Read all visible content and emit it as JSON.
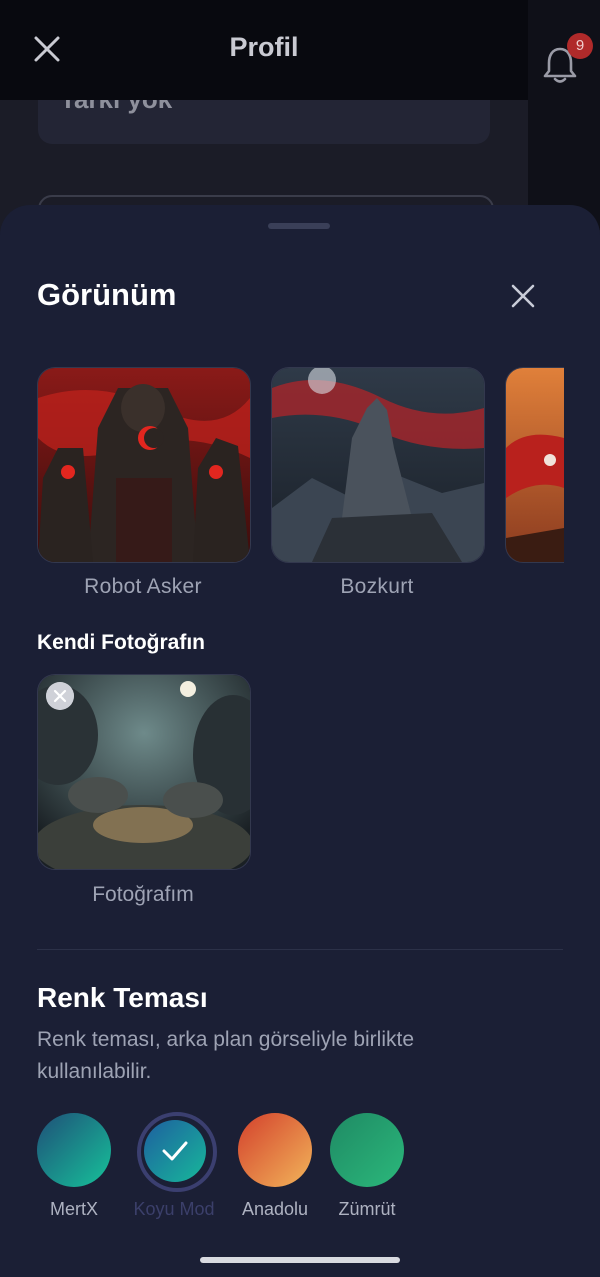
{
  "background_page": {
    "title": "Profil",
    "notification_count": "9",
    "card_text": "Tarkı yok",
    "close_icon": "close-icon",
    "bell_icon": "bell-icon"
  },
  "sheet": {
    "title": "Görünüm",
    "close_icon": "close-icon",
    "backgrounds": [
      {
        "label": "Robot Asker",
        "image": "robot-soldier-flag-image"
      },
      {
        "label": "Bozkurt",
        "image": "grey-wolf-flag-image"
      },
      {
        "label": "",
        "image": "flag-sunset-image"
      }
    ],
    "own_photo_section": "Kendi Fotoğrafın",
    "own_photo": {
      "label": "Fotoğrafım",
      "image": "clouds-moon-image",
      "remove_icon": "remove-icon"
    },
    "color_theme": {
      "title": "Renk Teması",
      "description": "Renk teması, arka plan görseliyle birlikte kullanılabilir.",
      "themes": [
        {
          "label": "MertX",
          "colors": [
            "#1f4f78",
            "#16c29a"
          ],
          "selected": false
        },
        {
          "label": "Koyu Mod",
          "colors": [
            "#1e5fa0",
            "#17b89a"
          ],
          "selected": true
        },
        {
          "label": "Anadolu",
          "colors": [
            "#d3402c",
            "#f2b55a"
          ],
          "selected": false
        },
        {
          "label": "Zümrüt",
          "colors": [
            "#1f8a64",
            "#2bb87b"
          ],
          "selected": false
        }
      ],
      "check_icon": "check-icon"
    }
  }
}
